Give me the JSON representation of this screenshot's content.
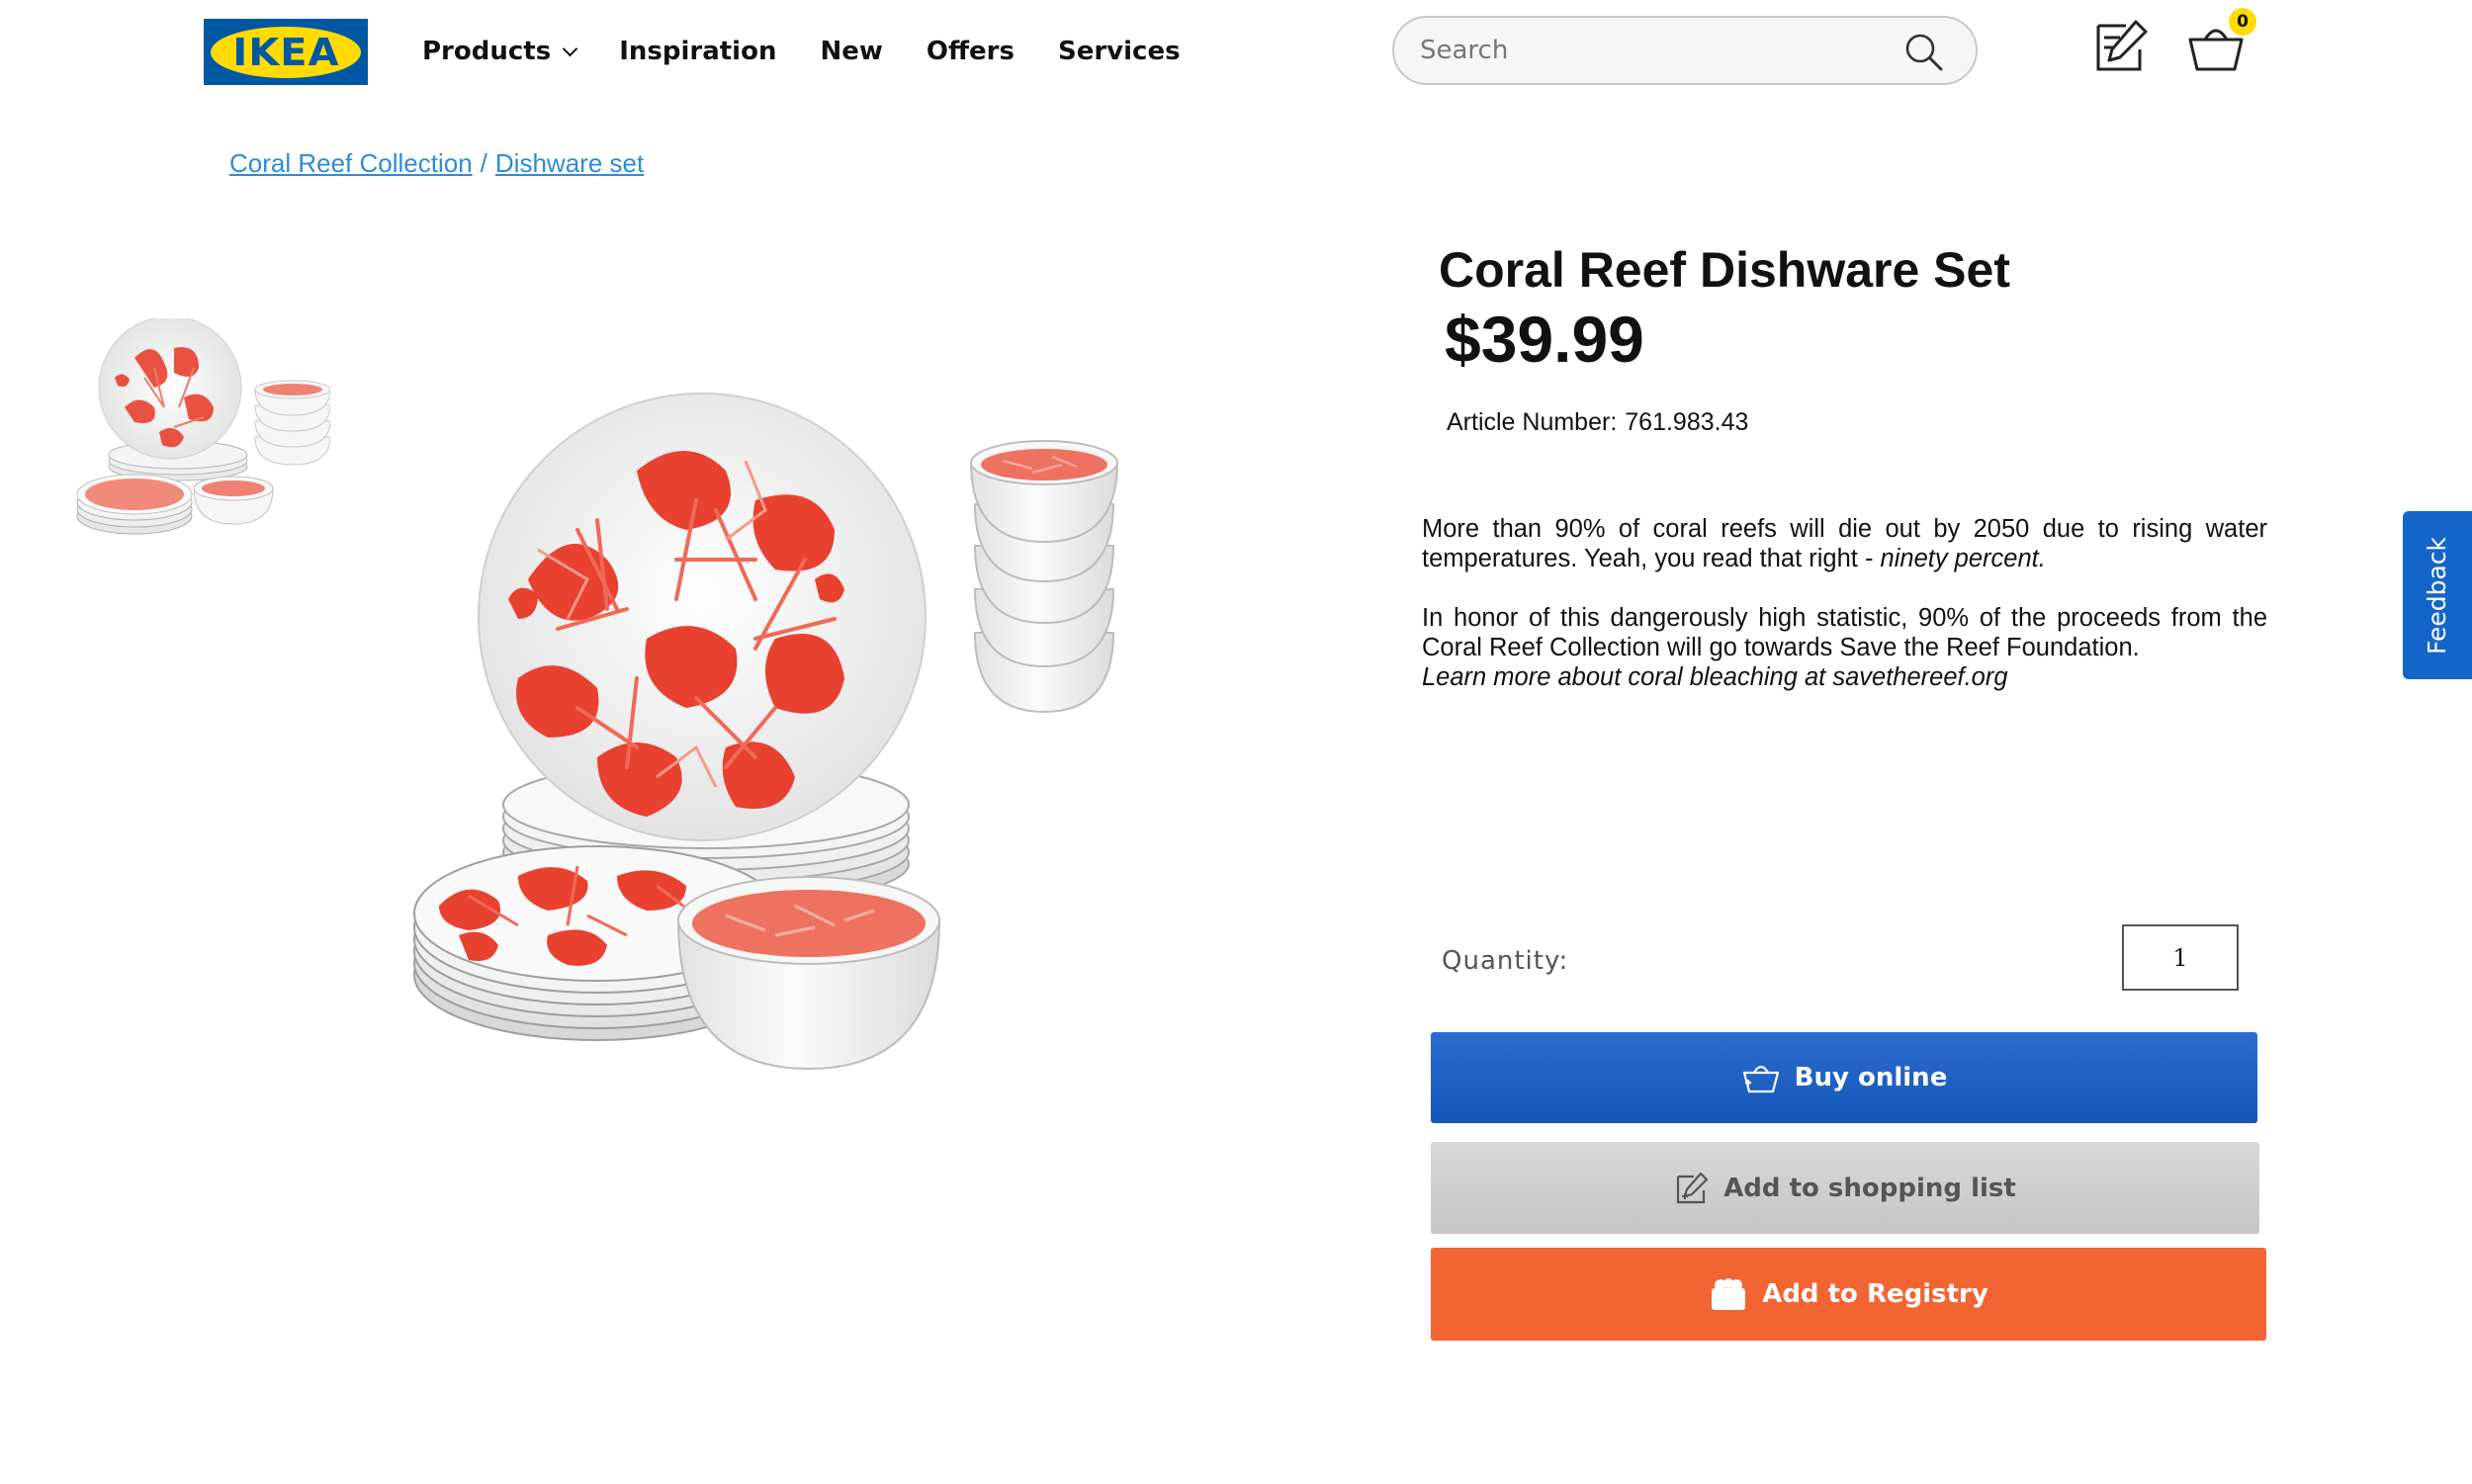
{
  "header": {
    "logo_text": "IKEA",
    "nav": [
      {
        "label": "Products"
      },
      {
        "label": "Inspiration"
      },
      {
        "label": "New"
      },
      {
        "label": "Offers"
      },
      {
        "label": "Services"
      }
    ],
    "search_placeholder": "Search",
    "cart_count": "0",
    "icons": [
      "shopping-list-icon",
      "cart-icon",
      "search-icon"
    ]
  },
  "breadcrumb": {
    "items": [
      "Coral Reef Collection",
      "Dishware set"
    ],
    "separator": "/"
  },
  "product": {
    "title": "Coral Reef Dishware Set",
    "price": "$39.99",
    "article_label": "Article Number:",
    "article_number": "761.983.43",
    "desc1_text": "More than 90% of coral reefs will die out by 2050 due to rising water temperatures. Yeah, you read that right - ",
    "desc1_italic": "ninety percent.",
    "desc2_text": "In honor of this dangerously high statistic, 90% of the proceeds from the Coral Reef Collection will go towards Save the Reef Foundation.",
    "desc2_italic": "Learn more about coral bleaching at savethereef.org"
  },
  "purchase": {
    "quantity_label": "Quantity:",
    "quantity_value": "1",
    "buy_label": "Buy online",
    "list_label": "Add to shopping list",
    "registry_label": "Add to Registry"
  },
  "feedback_label": "Feedback",
  "colors": {
    "ikea_blue": "#0058a3",
    "ikea_yellow": "#ffdb00",
    "buy_blue": "#1456b9",
    "registry_orange": "#f26532",
    "link_blue": "#2f8bd6",
    "coral_red": "#e8412f"
  }
}
